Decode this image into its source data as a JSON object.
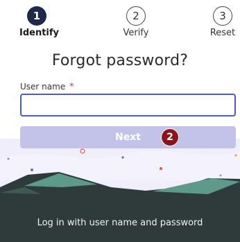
{
  "stepper": {
    "steps": [
      {
        "number": "1",
        "label": "Identify",
        "state": "active"
      },
      {
        "number": "2",
        "label": "Verify",
        "state": "upcoming"
      },
      {
        "number": "3",
        "label": "Reset",
        "state": "upcoming"
      }
    ]
  },
  "form": {
    "title": "Forgot password?",
    "username_label": "User name",
    "required_marker": "*",
    "username_value": "",
    "next_label": "Next"
  },
  "annotation": {
    "badge_number": "2"
  },
  "footer": {
    "login_link": "Log in with user name and password"
  },
  "colors": {
    "active_step": "#1f2a4a",
    "input_focus_border": "#4a5acb",
    "next_button": "#c3c3ea",
    "badge": "#8a1418",
    "footer_dark": "#2f3b3b",
    "mountain_green": "#5d9a8a",
    "sky": "#f0eefb"
  }
}
